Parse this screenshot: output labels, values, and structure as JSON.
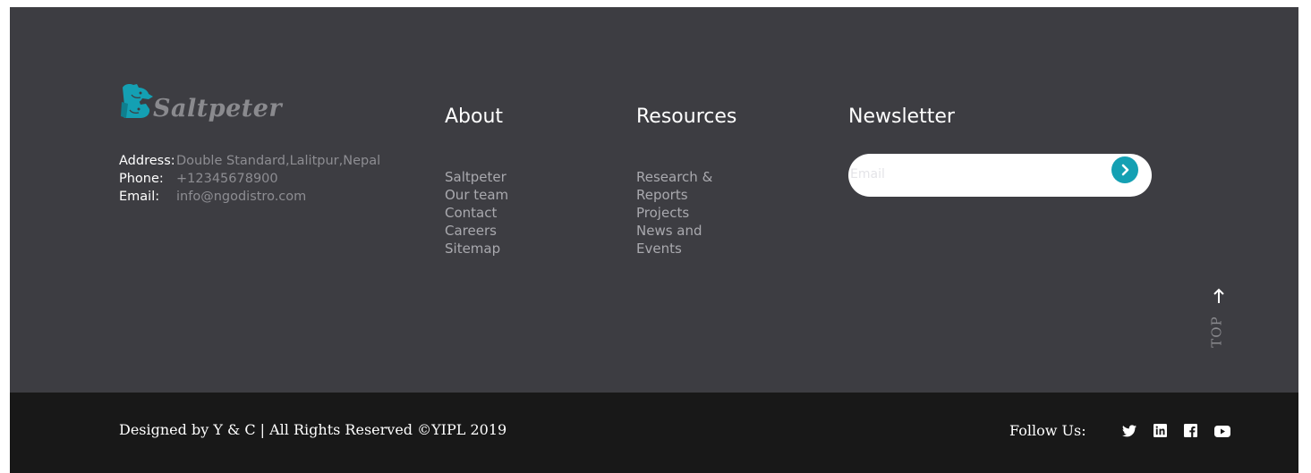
{
  "brand": {
    "name": "Saltpeter",
    "accent_color": "#14a0b3",
    "logo_icon": "dog-cat-logo-icon"
  },
  "contact": {
    "address_label": "Address:",
    "address": "Double Standard,Lalitpur,Nepal",
    "phone_label": "Phone:",
    "phone": "+12345678900",
    "email_label": "Email:",
    "email": "info@ngodistro.com"
  },
  "about": {
    "title": "About",
    "links": [
      "Saltpeter",
      "Our team",
      "Contact",
      "Careers",
      "Sitemap"
    ]
  },
  "resources": {
    "title": "Resources",
    "links": [
      "Research &",
      "Reports",
      "Projects",
      "News and",
      "Events"
    ]
  },
  "newsletter": {
    "title": "Newsletter",
    "placeholder": "Email",
    "submit_icon": "chevron-right-icon"
  },
  "top": {
    "label": "TOP",
    "icon": "arrow-up-icon"
  },
  "bottom": {
    "copyright": "Designed by Y & C | All Rights Reserved ©YIPL 2019",
    "follow_label": "Follow Us:",
    "social_icons": [
      "twitter-icon",
      "linkedin-icon",
      "facebook-icon",
      "youtube-icon"
    ]
  },
  "colors": {
    "footer_bg": "#3d3d42",
    "bottom_bg": "#181818"
  }
}
